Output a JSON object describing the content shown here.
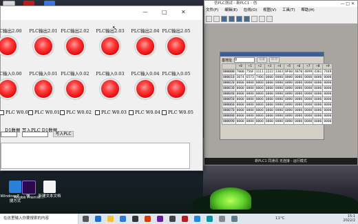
{
  "plc_window": {
    "title": "仿PLC测试 - 新PLC1 - 仿",
    "menu": [
      "文件(F)",
      "编辑(E)",
      "在线(O)",
      "视图(V)",
      "工具(T)",
      "帮助(H)"
    ],
    "panel": {
      "addr_label": "基地址",
      "addr_value": "0",
      "buttons": [
        "设置",
        "取消"
      ],
      "columns": [
        "+0",
        "+1",
        "+2",
        "+3",
        "+4",
        "+5",
        "+6",
        "+7",
        "+8",
        "+9"
      ],
      "rows": [
        {
          "addr": "000000",
          "cells": [
            "7000",
            "756F",
            "1111",
            "2222",
            "3363",
            "0F60",
            "4870",
            "4899",
            "4361",
            "7449"
          ]
        },
        {
          "addr": "000010",
          "cells": [
            "3074",
            "6573",
            "7406",
            "0000",
            "0000",
            "0000",
            "0000",
            "0000",
            "0000",
            "0000"
          ]
        },
        {
          "addr": "000020",
          "cells": [
            "0000",
            "0000",
            "0000",
            "0000",
            "0000",
            "0000",
            "0000",
            "0000",
            "0000",
            "0000"
          ]
        },
        {
          "addr": "000030",
          "cells": [
            "0000",
            "0000",
            "0000",
            "0000",
            "0000",
            "0000",
            "0000",
            "0000",
            "0000",
            "0000"
          ]
        },
        {
          "addr": "000040",
          "cells": [
            "0000",
            "0000",
            "0000",
            "0000",
            "0000",
            "0000",
            "0000",
            "0000",
            "0000",
            "0000"
          ]
        },
        {
          "addr": "000050",
          "cells": [
            "0000",
            "0000",
            "0000",
            "0000",
            "0000",
            "0000",
            "0000",
            "0000",
            "0000",
            "0000"
          ]
        },
        {
          "addr": "000060",
          "cells": [
            "0000",
            "0000",
            "0000",
            "0000",
            "0000",
            "0000",
            "0000",
            "0000",
            "0000",
            "0000"
          ]
        },
        {
          "addr": "000070",
          "cells": [
            "0000",
            "0000",
            "0000",
            "0000",
            "0000",
            "0000",
            "0000",
            "0000",
            "0000",
            "0000"
          ]
        },
        {
          "addr": "000080",
          "cells": [
            "0000",
            "0000",
            "0000",
            "0000",
            "0000",
            "0000",
            "0000",
            "0000",
            "0000",
            "0000"
          ]
        },
        {
          "addr": "000090",
          "cells": [
            "0000",
            "0000",
            "0000",
            "0000",
            "0000",
            "0000",
            "0000",
            "0000",
            "0000",
            "0000"
          ]
        }
      ]
    },
    "status": "新PLC1 同通讯 无连接 - 运行模式"
  },
  "hmi": {
    "title_controls": [
      "—",
      "□",
      "✕"
    ],
    "outputs": [
      "PLC输出2.00",
      "PLC输出2.01",
      "PLC输出2.02",
      "PLC输出2.03",
      "PLC输出2.04",
      "PLC输出2.05"
    ],
    "inputs": [
      "PLC输入0.00",
      "PLC输入0.01",
      "PLC输入0.02",
      "PLC输入0.03",
      "PLC输入0.04",
      "PLC输入0.05"
    ],
    "checkboxes": [
      "PLC W0.00",
      "PLC W0.01",
      "PLC W0.02",
      "PLC W0.03",
      "PLC W0.04",
      "PLC W0.05"
    ],
    "d1_label": "D1数据",
    "write_d1_label": "写入PLC D1数据",
    "write_button": "写入PLC",
    "lamp_color": "#ff2a2a"
  },
  "desktop_icons": [
    {
      "label": "WindowsF... - 快捷方式",
      "color": "#2a7fd8"
    },
    {
      "label": "Adobe Premie...",
      "color": "#2a0a4a"
    },
    {
      "label": "新建文本文档",
      "color": "#f4f4f4"
    }
  ],
  "taskbar": {
    "search_placeholder": "在这里输入你要搜索的内容",
    "weather": "11°C",
    "time": "15:1",
    "date": "2022/2"
  }
}
